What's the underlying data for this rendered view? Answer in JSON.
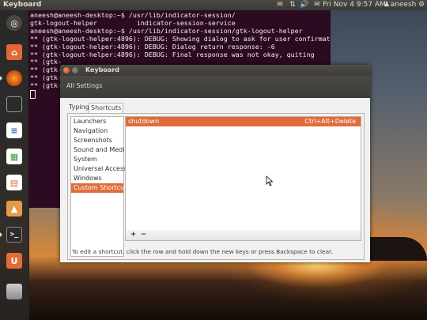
{
  "panel": {
    "app_title": "Keyboard",
    "datetime": "Fri Nov 4  9:57 AM",
    "user": "aneesh"
  },
  "launcher": {
    "items": [
      "dash",
      "home-folder",
      "firefox",
      "workspace-switcher",
      "libreoffice-writer",
      "libreoffice-calc",
      "libreoffice-impress",
      "ubuntu-software-center",
      "terminal",
      "ubuntu-one",
      "trash"
    ]
  },
  "terminal": {
    "lines": [
      "aneesh@aneesh-desktop:~$ /usr/lib/indicator-session/",
      "gtk-logout-helper          indicator-session-service",
      "aneesh@aneesh-desktop:~$ /usr/lib/indicator-session/gtk-logout-helper",
      "** (gtk-logout-helper:4896): DEBUG: Showing dialog to ask for user confirmation",
      "** (gtk-logout-helper:4896): DEBUG: Dialog return response: -6",
      "** (gtk-logout-helper:4896): DEBUG: Final response was not okay, quiting",
      "** (gtk-",
      "** (gtk-",
      "** (gtk-",
      "** (gtk-"
    ]
  },
  "window": {
    "title": "Keyboard",
    "all_settings": "All Settings",
    "tabs": [
      "Typing",
      "Shortcuts"
    ],
    "active_tab": "Shortcuts",
    "categories": [
      "Launchers",
      "Navigation",
      "Screenshots",
      "Sound and Media",
      "System",
      "Universal Access",
      "Windows",
      "Custom Shortcuts"
    ],
    "selected_category": "Custom Shortcuts",
    "shortcuts": [
      {
        "name": "shutdown",
        "accel": "Ctrl+Alt+Delete"
      }
    ],
    "add_label": "+",
    "remove_label": "−",
    "hint": "To edit a shortcut, click the row and hold down the new keys or press Backspace to clear."
  },
  "colors": {
    "accent": "#e06c3a",
    "terminal_bg": "#2c0a22",
    "panel_bg": "#3c3b37"
  }
}
